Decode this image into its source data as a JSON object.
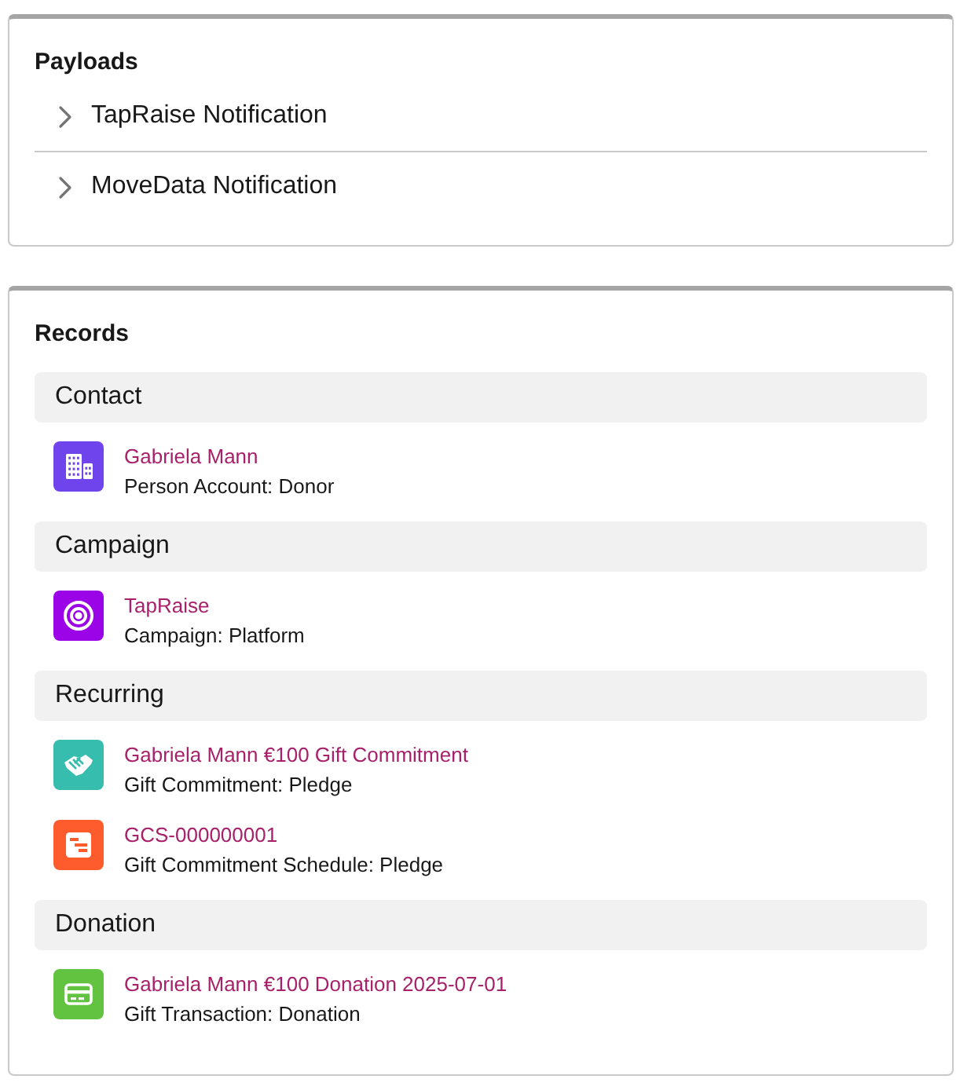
{
  "payloads": {
    "title": "Payloads",
    "items": [
      {
        "label": "TapRaise Notification",
        "expanded": false
      },
      {
        "label": "MoveData Notification",
        "expanded": false
      }
    ]
  },
  "records": {
    "title": "Records",
    "sections": [
      {
        "heading": "Contact",
        "items": [
          {
            "kind": "account",
            "name": "Gabriela Mann",
            "subtitle": "Person Account: Donor"
          }
        ]
      },
      {
        "heading": "Campaign",
        "items": [
          {
            "kind": "campaign",
            "name": "TapRaise",
            "subtitle": "Campaign: Platform"
          }
        ]
      },
      {
        "heading": "Recurring",
        "items": [
          {
            "kind": "commitment",
            "name": "Gabriela Mann €100 Gift Commitment",
            "subtitle": "Gift Commitment: Pledge"
          },
          {
            "kind": "schedule",
            "name": "GCS-000000001",
            "subtitle": "Gift Commitment Schedule: Pledge"
          }
        ]
      },
      {
        "heading": "Donation",
        "items": [
          {
            "kind": "transaction",
            "name": "Gabriela Mann €100 Donation 2025-07-01",
            "subtitle": "Gift Transaction: Donation"
          }
        ]
      }
    ]
  }
}
